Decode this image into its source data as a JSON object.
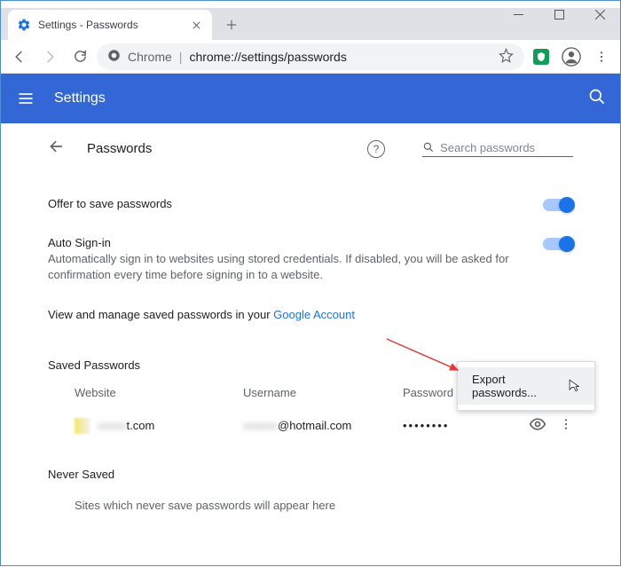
{
  "window": {
    "title": "Settings - Passwords"
  },
  "omnibox": {
    "scheme": "Chrome",
    "url": "chrome://settings/passwords"
  },
  "settings_header": {
    "title": "Settings"
  },
  "page": {
    "title": "Passwords",
    "search_placeholder": "Search passwords"
  },
  "settings": {
    "offer_save": {
      "label": "Offer to save passwords"
    },
    "auto_signin": {
      "label": "Auto Sign-in",
      "desc": "Automatically sign in to websites using stored credentials. If disabled, you will be asked for confirmation every time before signing in to a website."
    },
    "manage_text": "View and manage saved passwords in your ",
    "manage_link": "Google Account"
  },
  "saved": {
    "heading": "Saved Passwords",
    "cols": {
      "website": "Website",
      "username": "Username",
      "password": "Password"
    },
    "rows": [
      {
        "website_suffix": "t.com",
        "username_suffix": "@hotmail.com",
        "password_mask": "••••••••"
      }
    ]
  },
  "never": {
    "heading": "Never Saved",
    "empty_text": "Sites which never save passwords will appear here"
  },
  "menu": {
    "export": "Export passwords..."
  }
}
